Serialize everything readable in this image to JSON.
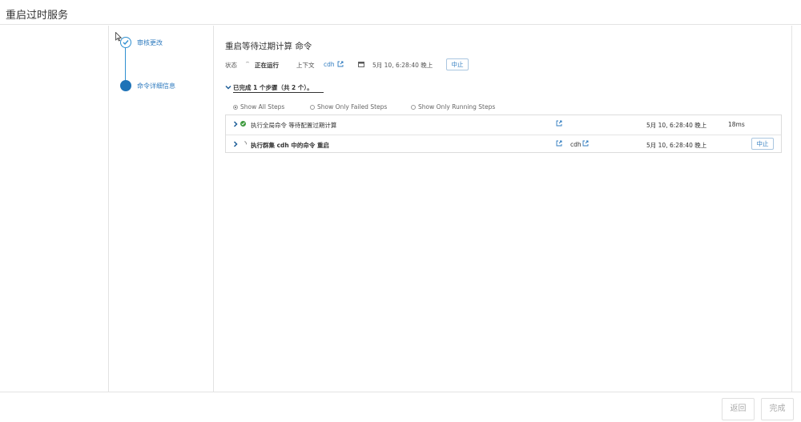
{
  "window": {
    "title": "重启过时服务"
  },
  "wizard": {
    "steps": [
      {
        "label": "审核更改",
        "state": "done"
      },
      {
        "label": "命令详细信息",
        "state": "current"
      }
    ]
  },
  "command": {
    "title": "重启等待过期计算 命令",
    "status_label": "状态",
    "status_value": "正在运行",
    "context_label": "上下文",
    "context_link": "cdh",
    "time": "5月 10, 6:28:40 晚上",
    "abort_label": "中止"
  },
  "summary": {
    "text": "已完成 1 个步骤（共 2 个）。"
  },
  "filters": [
    {
      "label": "Show All Steps",
      "selected": true
    },
    {
      "label": "Show Only Failed Steps",
      "selected": false
    },
    {
      "label": "Show Only Running Steps",
      "selected": false
    }
  ],
  "steps_table": [
    {
      "name": "执行全局命令 等待配置过期计算",
      "status": "success",
      "context": "",
      "time": "5月 10, 6:28:40 晚上",
      "duration": "18ms",
      "action": ""
    },
    {
      "name": "执行群集 cdh 中的命令 重启",
      "status": "running",
      "context": "cdh",
      "time": "5月 10, 6:28:40 晚上",
      "duration": "",
      "action": "中止"
    }
  ],
  "footer": {
    "back_label": "返回",
    "finish_label": "完成"
  },
  "colors": {
    "accent": "#2f7bbf",
    "success": "#3c9a3c",
    "wizard_active": "#1f73b7"
  }
}
